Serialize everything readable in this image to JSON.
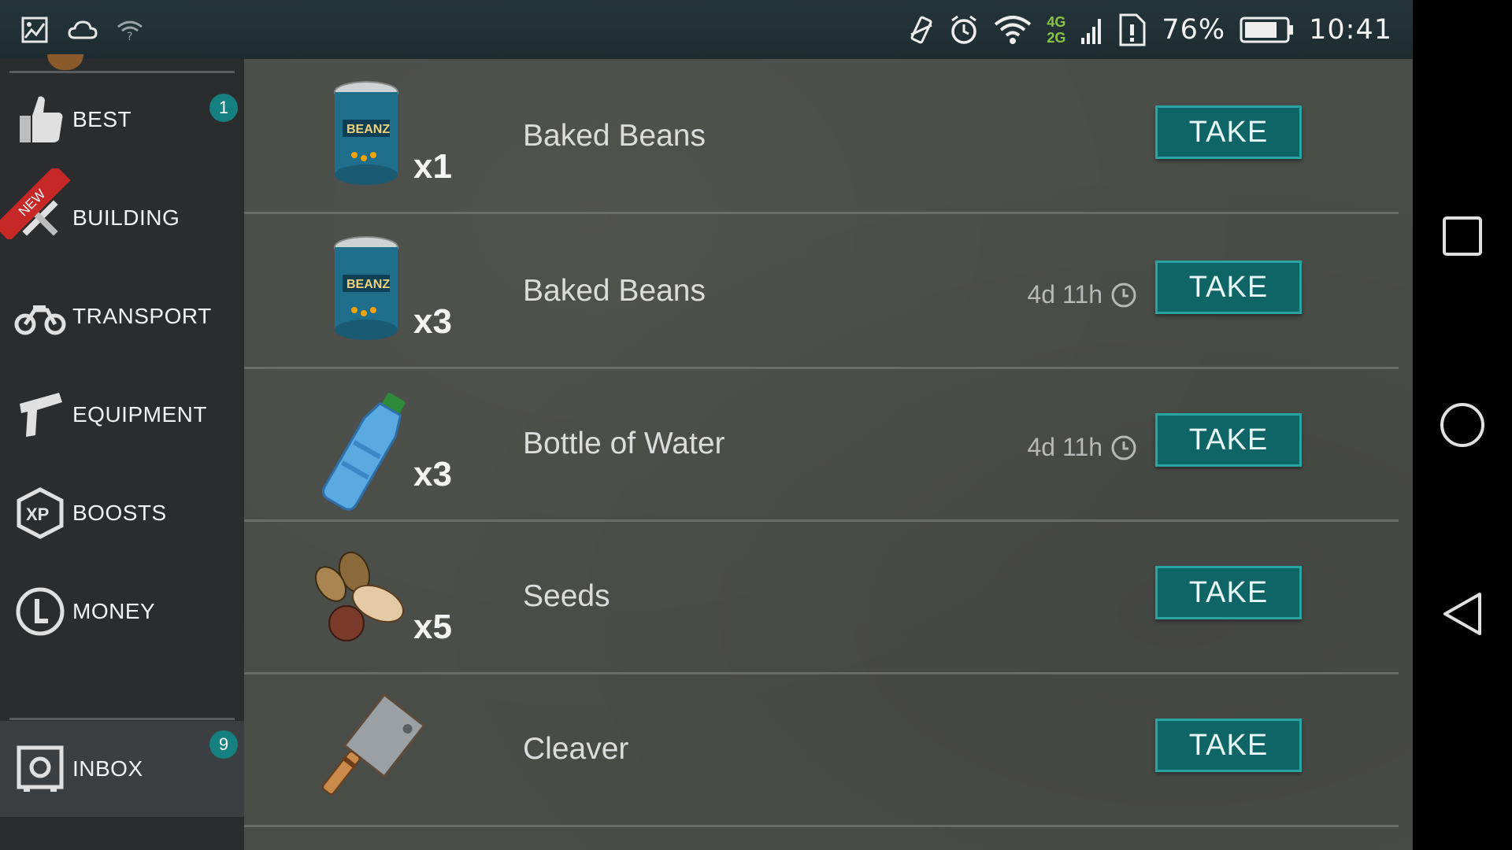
{
  "status_bar": {
    "battery_percent": "76%",
    "time": "10:41",
    "network_labels": [
      "4G",
      "2G"
    ],
    "icons": [
      "gallery-icon",
      "cloud-icon",
      "wifi-question-icon",
      "vibrate-icon",
      "alarm-icon",
      "wifi-icon",
      "signal-icon",
      "sim-alert-icon",
      "battery-icon"
    ]
  },
  "sidebar": {
    "items": [
      {
        "label": "BEST",
        "icon": "thumbs-up-icon",
        "badge": "1"
      },
      {
        "label": "BUILDING",
        "icon": "tools-icon",
        "ribbon": "NEW"
      },
      {
        "label": "TRANSPORT",
        "icon": "motorcycle-icon"
      },
      {
        "label": "EQUIPMENT",
        "icon": "pistol-icon"
      },
      {
        "label": "BOOSTS",
        "icon": "xp-icon"
      },
      {
        "label": "MONEY",
        "icon": "coin-icon"
      }
    ],
    "inbox": {
      "label": "INBOX",
      "icon": "safe-icon",
      "badge": "9"
    }
  },
  "rewards": [
    {
      "name": "Baked Beans",
      "qty": "x1",
      "timer": "",
      "action": "TAKE",
      "icon": "beans-can-icon"
    },
    {
      "name": "Baked Beans",
      "qty": "x3",
      "timer": "4d 11h",
      "action": "TAKE",
      "icon": "beans-can-icon"
    },
    {
      "name": "Bottle of Water",
      "qty": "x3",
      "timer": "4d 11h",
      "action": "TAKE",
      "icon": "water-bottle-icon"
    },
    {
      "name": "Seeds",
      "qty": "x5",
      "timer": "",
      "action": "TAKE",
      "icon": "seeds-icon"
    },
    {
      "name": "Cleaver",
      "qty": "",
      "timer": "",
      "action": "TAKE",
      "icon": "cleaver-icon"
    }
  ],
  "can_label": "BEANZ",
  "colors": {
    "accent": "#0f6566",
    "badge": "#15807f",
    "new_ribbon": "#c62828",
    "sidebar_bg": "#2a2c2e",
    "content_bg": "#4a4c48"
  }
}
